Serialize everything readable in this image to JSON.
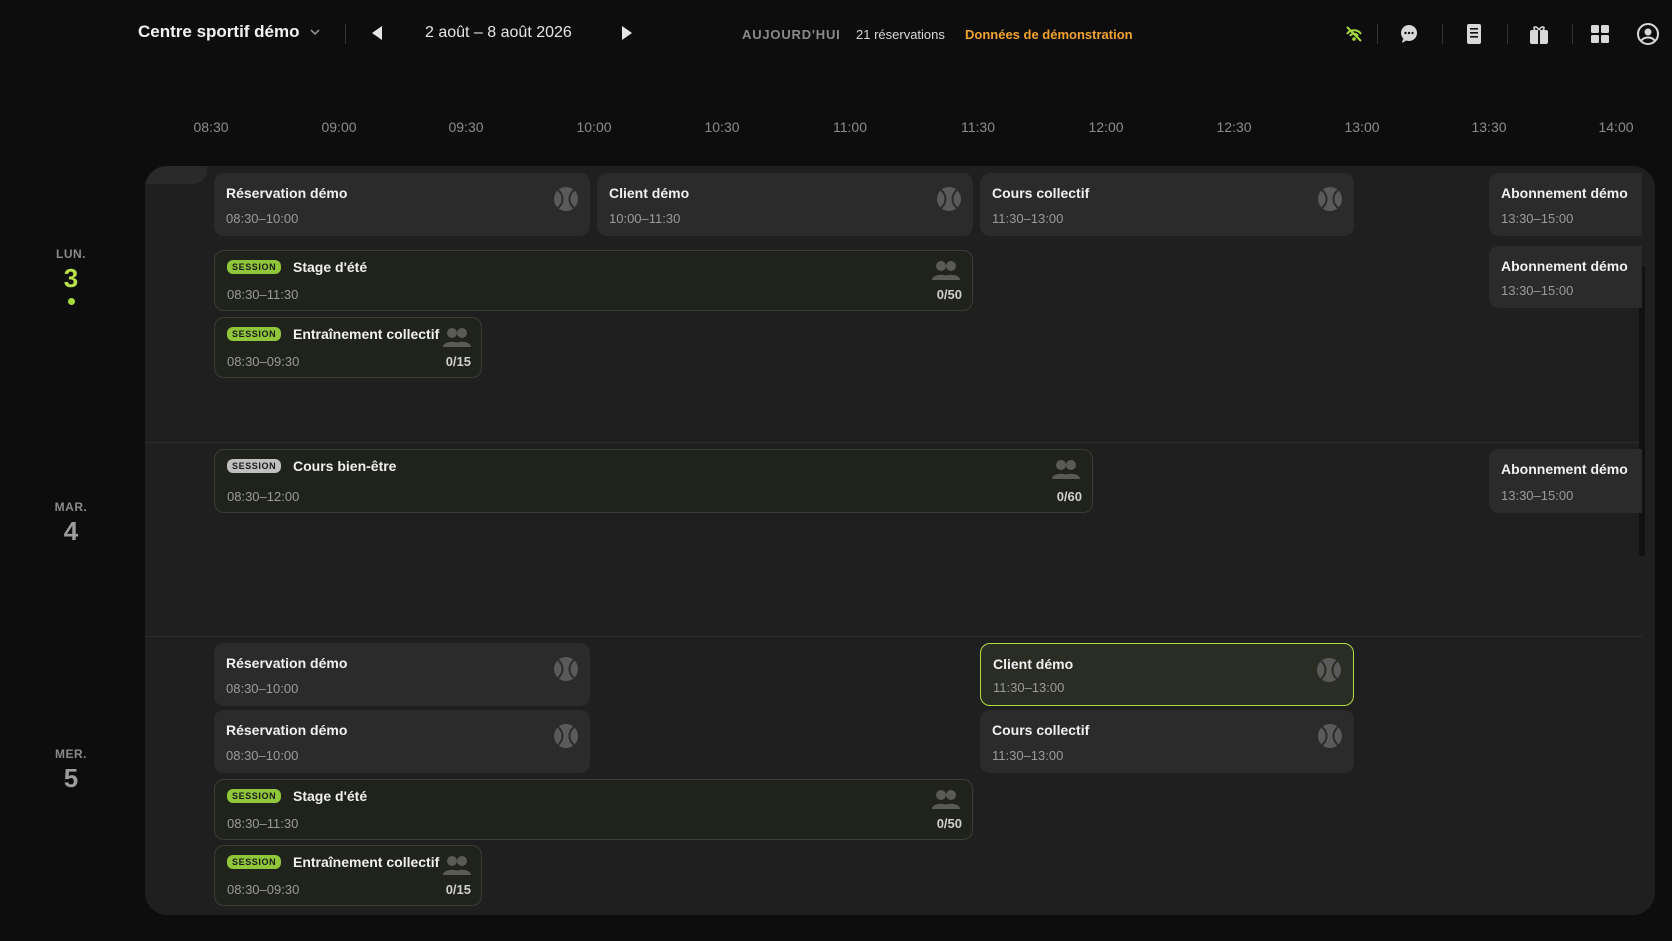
{
  "header": {
    "venue": "Centre sportif démo",
    "date_range": "2 août – 8 août 2026",
    "today_label": "AUJOURD'HUI",
    "reservations_count": "21 réservations",
    "demo_label": "Données de démonstration"
  },
  "icons": [
    "no-signal-icon",
    "chat-icon",
    "document-icon",
    "gift-icon",
    "grid-icon",
    "account-icon"
  ],
  "colors": {
    "accent": "#b3dc3f",
    "warning": "#f2a22e",
    "background": "#0d0d0d",
    "board": "#1f1f1f"
  },
  "time_ticks": [
    "08:30",
    "09:00",
    "09:30",
    "10:00",
    "10:30",
    "11:00",
    "11:30",
    "12:00",
    "12:30",
    "13:00",
    "13:30",
    "14:00"
  ],
  "days": [
    {
      "dow": "LUN.",
      "num": "3"
    },
    {
      "dow": "MAR.",
      "num": "4"
    },
    {
      "dow": "MER.",
      "num": "5"
    }
  ],
  "session_badge": "SESSION",
  "events": {
    "mon_res": {
      "title": "Réservation démo",
      "time": "08:30–10:00"
    },
    "mon_client": {
      "title": "Client démo",
      "time": "10:00–11:30"
    },
    "mon_cours": {
      "title": "Cours collectif",
      "time": "11:30–13:00"
    },
    "mon_abo1": {
      "title": "Abonnement démo",
      "time": "13:30–15:00"
    },
    "mon_abo2": {
      "title": "Abonnement démo",
      "time": "13:30–15:00"
    },
    "mon_stage": {
      "title": "Stage d'été",
      "time": "08:30–11:30",
      "capacity": "0/50"
    },
    "mon_entr": {
      "title": "Entraînement collectif",
      "time": "08:30–09:30",
      "capacity": "0/15"
    },
    "tue_bien": {
      "title": "Cours bien-être",
      "time": "08:30–12:00",
      "capacity": "0/60"
    },
    "tue_abo": {
      "title": "Abonnement démo",
      "time": "13:30–15:00"
    },
    "wed_res1": {
      "title": "Réservation démo",
      "time": "08:30–10:00"
    },
    "wed_client": {
      "title": "Client démo",
      "time": "11:30–13:00"
    },
    "wed_res2": {
      "title": "Réservation démo",
      "time": "08:30–10:00"
    },
    "wed_cours": {
      "title": "Cours collectif",
      "time": "11:30–13:00"
    },
    "wed_stage": {
      "title": "Stage d'été",
      "time": "08:30–11:30",
      "capacity": "0/50"
    },
    "wed_entr": {
      "title": "Entraînement collectif",
      "time": "08:30–09:30",
      "capacity": "0/15"
    }
  }
}
